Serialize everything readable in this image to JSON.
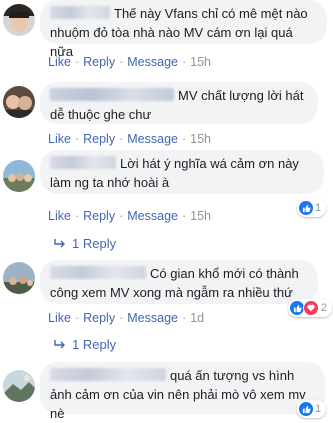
{
  "comments": [
    {
      "text": "Thế này Vfans chỉ có mê mệt nào nhuộm đỏ tòa nhà nào MV cám ơn lại quá nữa",
      "like": "Like",
      "reply": "Reply",
      "message": "Message",
      "time": "15h"
    },
    {
      "text": "MV chất lượng lời hát dễ thuộc ghe chư",
      "like": "Like",
      "reply": "Reply",
      "message": "Message",
      "time": "15h"
    },
    {
      "text": "Lời hát ý nghĩa wá cảm ơn này làm ng ta nhớ hoài à",
      "like": "Like",
      "reply": "Reply",
      "message": "Message",
      "time": "15h",
      "reaction_count": "1",
      "replies": "1 Reply"
    },
    {
      "text": "Có gian khổ mới có thành công xem MV xong mà ngẫm ra nhiều thứ",
      "like": "Like",
      "reply": "Reply",
      "message": "Message",
      "time": "1d",
      "reaction_count": "2",
      "replies": "1 Reply"
    },
    {
      "text": "quá ấn tượng vs hình ảnh cảm ơn của vin nên phải mò vô xem mv nè",
      "reaction_count": "1"
    }
  ],
  "icons": {
    "like": "thumbs-up-icon",
    "love": "heart-icon",
    "reply_arrow": "reply-arrow-icon"
  },
  "colors": {
    "link": "#4267b2",
    "meta": "#90949c",
    "bubble": "#f2f3f5",
    "like": "#1877f2",
    "love": "#f33e58"
  }
}
